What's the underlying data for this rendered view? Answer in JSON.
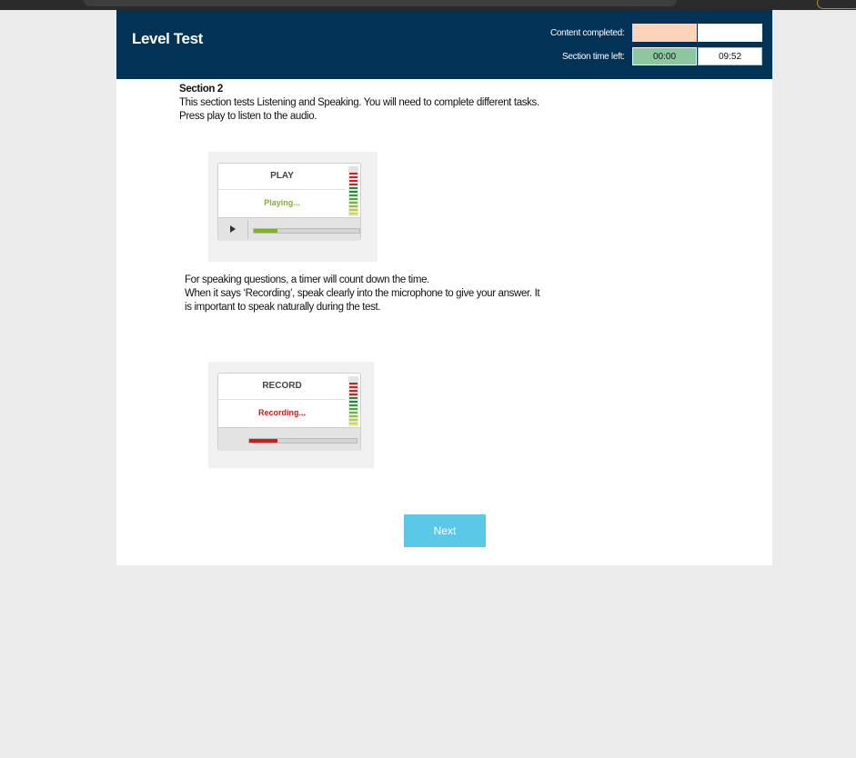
{
  "header": {
    "title": "Level Test",
    "content_completed_label": "Content completed:",
    "section_time_label": "Section time left:",
    "elapsed_time": "00:00",
    "time_left": "09:52"
  },
  "section": {
    "heading": "Section 2",
    "intro_line1": "This section tests Listening and Speaking. You will need to complete different tasks.",
    "intro_line2": "Press play to listen to the audio.",
    "speaking_line1": "For speaking questions, a timer will count down the time.",
    "speaking_line2": "When it says ‘Recording’, speak clearly into the microphone to give your answer. It",
    "speaking_line3": "is important to speak naturally during the test."
  },
  "play_widget": {
    "label": "PLAY",
    "status": "Playing...",
    "progress": 0.22,
    "status_color": "#7ab51d"
  },
  "record_widget": {
    "label": "RECORD",
    "status": "Recording...",
    "progress": 0.26,
    "status_color": "#cc1d1d"
  },
  "next_button": {
    "label": "Next"
  },
  "colors": {
    "header_bg": "#023256",
    "content_completed_fill": "#fcd3bb",
    "time_elapsed_fill": "#8cc79f",
    "next_button_bg": "#5bc8e8",
    "meter": [
      "#cf2027",
      "#cf2027",
      "#cf2027",
      "#cf2027",
      "#1b8a3a",
      "#1b8a3a",
      "#2e9b3d",
      "#4aa73a",
      "#6eb53a",
      "#8dc23a",
      "#b5d036",
      "#d2dc34"
    ]
  }
}
